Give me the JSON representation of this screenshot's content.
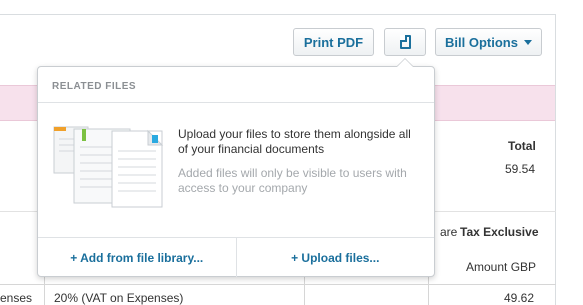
{
  "toolbar": {
    "print_pdf": "Print PDF",
    "bill_options": "Bill Options"
  },
  "background": {
    "total_label": "Total",
    "total_value": "59.54",
    "amounts_are": "are",
    "tax_exclusive": "Tax Exclusive",
    "amount_header": "Amount GBP",
    "row_account": "enses",
    "row_tax": "20% (VAT on Expenses)",
    "row_amount": "49.62"
  },
  "popover": {
    "title": "RELATED FILES",
    "main_text": "Upload your files to store them alongside all of your financial documents",
    "sub_text": "Added files will only be visible to users with access to your company",
    "add_from_library": "+ Add from file library...",
    "upload_files": "+ Upload files..."
  },
  "colors": {
    "accent": "#1a6f9c",
    "pink_strip": "#f7e1ec"
  }
}
